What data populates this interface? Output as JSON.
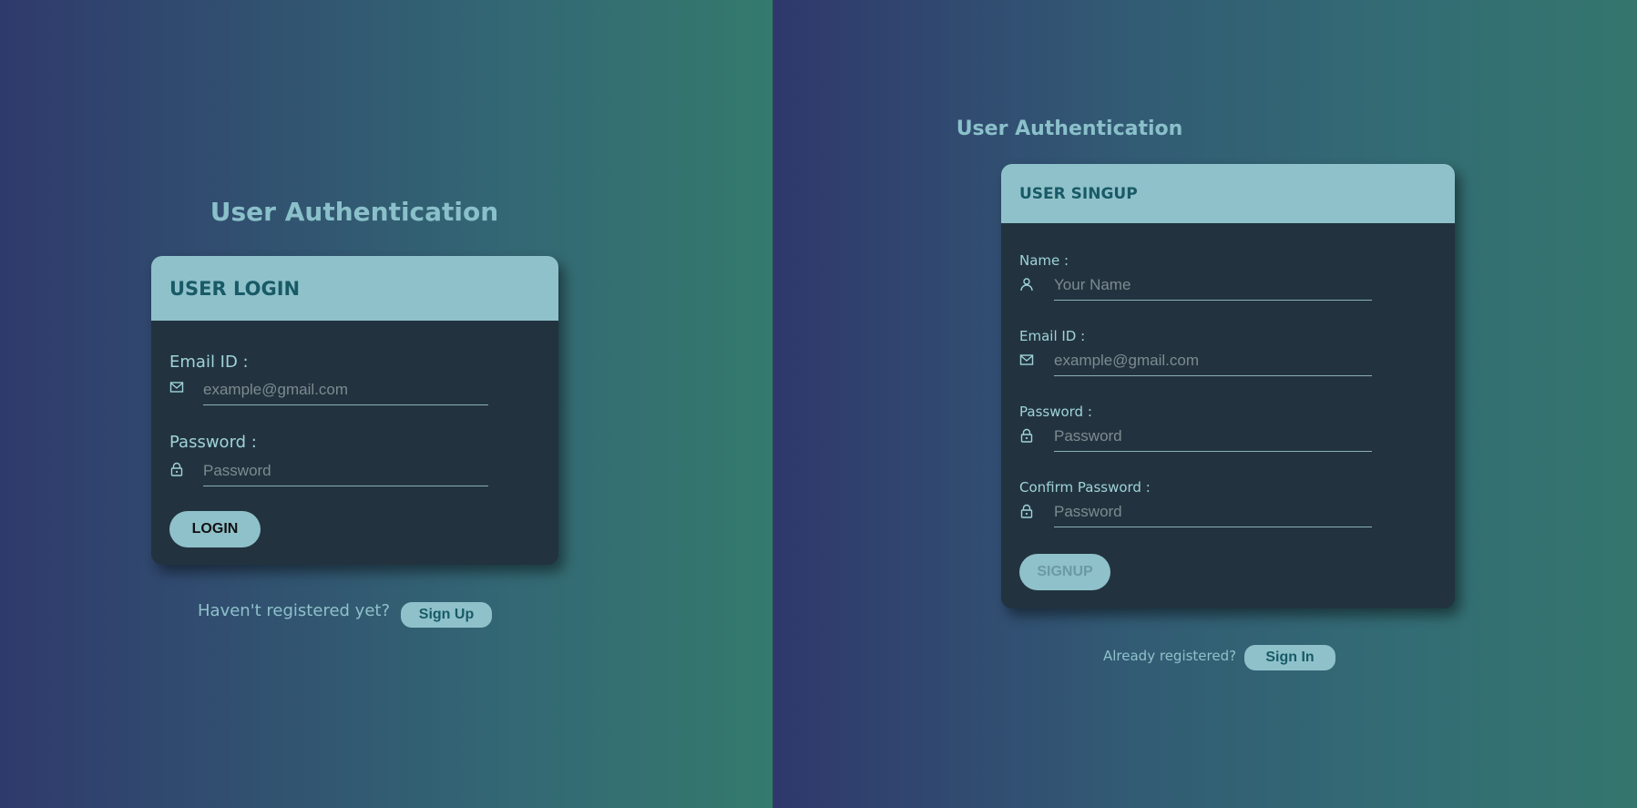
{
  "login_panel": {
    "title": "User Authentication",
    "card_header": "USER LOGIN",
    "email": {
      "label": "Email ID :",
      "placeholder": "example@gmail.com",
      "value": ""
    },
    "password": {
      "label": "Password :",
      "placeholder": "Password",
      "value": ""
    },
    "submit_label": "LOGIN",
    "footer_text": "Haven't registered yet?",
    "footer_button": "Sign Up"
  },
  "signup_panel": {
    "title": "User Authentication",
    "card_header": "USER SINGUP",
    "name": {
      "label": "Name :",
      "placeholder": "Your Name",
      "value": ""
    },
    "email": {
      "label": "Email ID :",
      "placeholder": "example@gmail.com",
      "value": ""
    },
    "password": {
      "label": "Password :",
      "placeholder": "Password",
      "value": ""
    },
    "confirm_password": {
      "label": "Confirm Password :",
      "placeholder": "Password",
      "value": ""
    },
    "submit_label": "SIGNUP",
    "footer_text": "Already registered?",
    "footer_button": "Sign In"
  },
  "icons": {
    "email": "mail-icon",
    "password": "lock-icon",
    "name": "user-icon"
  },
  "colors": {
    "accent": "#8fc1ca",
    "header_text": "#185a66",
    "card_bg": "#22333f",
    "label_text": "#9fd3d8"
  }
}
